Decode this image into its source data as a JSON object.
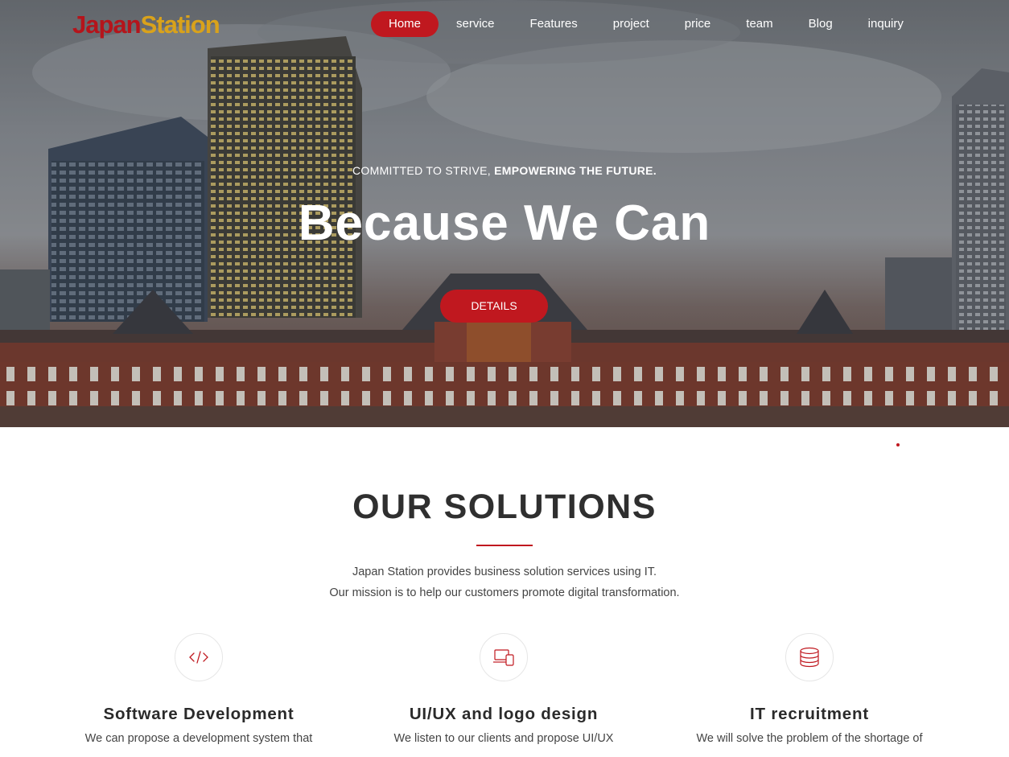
{
  "brand": {
    "part1": "Japan",
    "part2": "Station",
    "color1": "#b5141b",
    "color2": "#d9a21b"
  },
  "nav": {
    "items": [
      {
        "label": "Home",
        "active": true
      },
      {
        "label": "service"
      },
      {
        "label": "Features"
      },
      {
        "label": "project"
      },
      {
        "label": "price"
      },
      {
        "label": "team"
      },
      {
        "label": "Blog"
      },
      {
        "label": "inquiry"
      }
    ]
  },
  "hero": {
    "tagline_regular": "COMMITTED TO STRIVE, ",
    "tagline_bold": "EMPOWERING THE FUTURE.",
    "headline": "Because We Can",
    "button": "DETAILS"
  },
  "solutions": {
    "title": "OUR SOLUTIONS",
    "subtitle_line1": "Japan Station provides business solution services using IT.",
    "subtitle_line2": "Our mission is to help our customers promote digital transformation.",
    "cards": [
      {
        "icon": "code-icon",
        "title": "Software Development",
        "text": "We can propose a development system that"
      },
      {
        "icon": "devices-icon",
        "title": "UI/UX and logo design",
        "text": "We listen to our clients and propose UI/UX"
      },
      {
        "icon": "database-icon",
        "title": "IT recruitment",
        "text": "We will solve the problem of the shortage of"
      }
    ]
  },
  "colors": {
    "accent": "#c0181f",
    "text": "#333333"
  }
}
